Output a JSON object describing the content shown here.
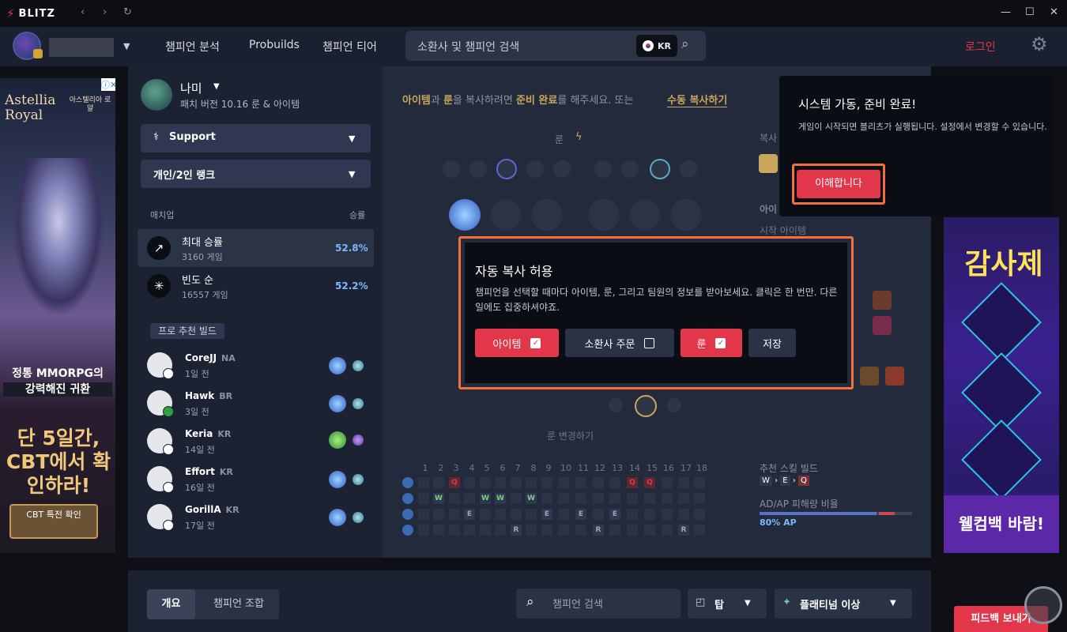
{
  "app": {
    "brand": "BLITZ",
    "nav_back": "‹",
    "nav_fwd": "›",
    "reload": "↻",
    "win_min": "—",
    "win_max": "☐",
    "win_close": "✕"
  },
  "navbar": {
    "links": [
      "챔피언 분석",
      "Probuilds",
      "챔피언 티어"
    ],
    "search_placeholder": "소환사 및 챔피언 검색",
    "region": "KR",
    "login": "로그인"
  },
  "ad_left": {
    "title": "Astellia Royal",
    "subtitle": "아스텔리아 로얄",
    "line1": "정통 MMORPG의",
    "line2": "강력해진 귀환",
    "big": "단 5일간, CBT에서 확인하라!",
    "cta": "CBT 특전 확인",
    "info": "ⓘ✕"
  },
  "ad_right": {
    "title": "감사제",
    "footer": "웰컴백 바람!"
  },
  "champion": {
    "name": "나미",
    "patch": "패치 버전 10.16 룬 & 아이템",
    "role": "Support",
    "queue": "개인/2인 랭크"
  },
  "matchup": {
    "label": "매치업",
    "winrate_label": "승률",
    "rows": [
      {
        "title": "최대 승률",
        "sub": "3160 게임",
        "rate": "52.8%",
        "icon": "↗"
      },
      {
        "title": "빈도 순",
        "sub": "16557 게임",
        "rate": "52.2%",
        "icon": "✳"
      }
    ]
  },
  "pro": {
    "label": "프로 추천 빌드",
    "players": [
      {
        "name": "CoreJJ",
        "region": "NA",
        "time": "1일 전"
      },
      {
        "name": "Hawk",
        "region": "BR",
        "time": "3일 전"
      },
      {
        "name": "Keria",
        "region": "KR",
        "time": "14일 전"
      },
      {
        "name": "Effort",
        "region": "KR",
        "time": "16일 전"
      },
      {
        "name": "GorillA",
        "region": "KR",
        "time": "17일 전"
      }
    ]
  },
  "center": {
    "hint_pre": "아이템",
    "hint_and": "과 ",
    "hint_rune": "룬",
    "hint_mid": "을 복사하려면 ",
    "hint_ready": "준비 완료",
    "hint_post": "를 해주세요. 또는 ",
    "manual_copy": "수동 복사하기",
    "rune_label": "룬",
    "copy_label": "복사",
    "item_label": "아이",
    "start_item": "시작 아이템",
    "rune_change": "룬 변경하기",
    "skill_label": "추천 스킬 빌드",
    "ratio_label": "AD/AP 피해량 비율",
    "ratio_value": "80% AP",
    "ap_ratio": 0.8,
    "levels": [
      "1",
      "2",
      "3",
      "4",
      "5",
      "6",
      "7",
      "8",
      "9",
      "10",
      "11",
      "12",
      "13",
      "14",
      "15",
      "16",
      "17",
      "18"
    ]
  },
  "system_popup": {
    "title": "시스템 가동, 준비 완료!",
    "body": "게임이 시작되면 블리츠가 실행됩니다. 설정에서 변경할 수 있습니다.",
    "button": "이해합니다"
  },
  "autocopy_modal": {
    "title": "자동 복사 허용",
    "body": "챔피언을 선택할 때마다 아이템, 룬, 그리고 팀원의 정보를 받아보세요. 클릭은 한 번만. 다른 일에도 집중하셔야죠.",
    "items": "아이템",
    "summoner": "소환사 주문",
    "rune": "룬",
    "save": "저장"
  },
  "bottom": {
    "tab_overview": "개요",
    "tab_combo": "챔피언 조합",
    "search_placeholder": "챔피언 검색",
    "role": "탑",
    "tier": "플래티넘 이상",
    "feedback": "피드백 보내기"
  },
  "colors": {
    "accent": "#e2364a",
    "highlight": "#f3703c",
    "gold": "#c9a85c",
    "blue": "#79b8ff"
  }
}
